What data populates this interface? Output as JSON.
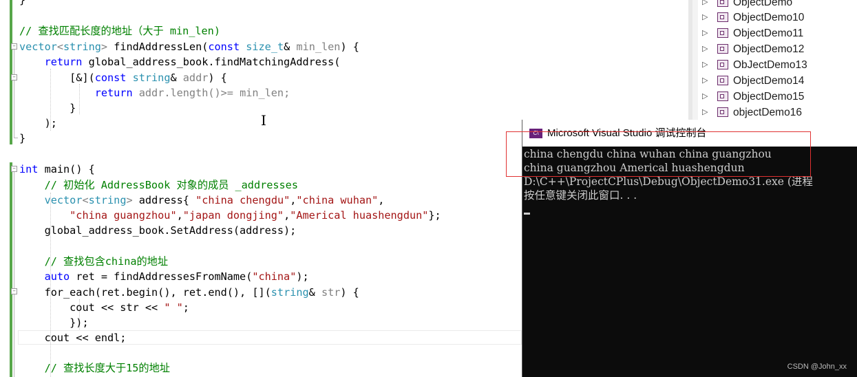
{
  "editor": {
    "top_fragment": "}",
    "comment_find_len": "// 查找匹配长度的地址（大于 min_len)",
    "comment_init": "// 初始化 AddressBook 对象的成员 _addresses",
    "comment_find_china": "// 查找包含china的地址",
    "comment_find_15": "// 查找长度大于15的地址",
    "kw_vector": "vector",
    "ty_string": "string",
    "fn_findAddressLen": "findAddressLen",
    "kw_const": "const",
    "ty_size_t": "size_t",
    "param_min_len": "min_len",
    "kw_return": "return",
    "global_call": "global_address_book.findMatchingAddress",
    "lambda_open": "[&](",
    "param_addr": "addr",
    "return_expr": "addr.length()>= min_len;",
    "kw_int": "int",
    "fn_main": "main",
    "var_address": "address{",
    "str_chengdu": "\"china chengdu\"",
    "str_wuhan": "\"china wuhan\"",
    "str_guangzhou": "\"china guangzhou\"",
    "str_japan": "\"japan dongjing\"",
    "str_america": "\"Americal huashengdun\"",
    "set_address": "global_address_book.SetAddress(address);",
    "kw_auto": "auto",
    "var_ret": "ret",
    "call_find_name": " = findAddressesFromName(",
    "str_china": "\"china\"",
    "fn_for_each": "for_each",
    "for_each_args_1": "(ret.begin(), ",
    "for_each_ret": "ret",
    "for_each_args_2": ".end(), [](",
    "param_str": "str",
    "cout_line_a": "cout << str << ",
    "str_space": "\" \"",
    "close_lambda": "});",
    "cout_endl": "cout << endl;"
  },
  "solution_explorer": {
    "items": [
      {
        "label": "ObjectDemo"
      },
      {
        "label": "ObjectDemo10"
      },
      {
        "label": "ObjectDemo11"
      },
      {
        "label": "ObjectDemo12"
      },
      {
        "label": "ObJectDemo13"
      },
      {
        "label": "ObjectDemo14"
      },
      {
        "label": "ObjectDemo15"
      },
      {
        "label": "objectDemo16"
      }
    ]
  },
  "console": {
    "icon_text": "C\\",
    "title": "Microsoft Visual Studio 调试控制台",
    "lines": [
      "china chengdu china wuhan china guangzhou",
      "china guangzhou Americal huashengdun",
      "D:\\C++\\ProjectCPlus\\Debug\\ObjectDemo31.exe (进程",
      "按任意键关闭此窗口. . ."
    ],
    "watermark": "CSDN @John_xx"
  }
}
